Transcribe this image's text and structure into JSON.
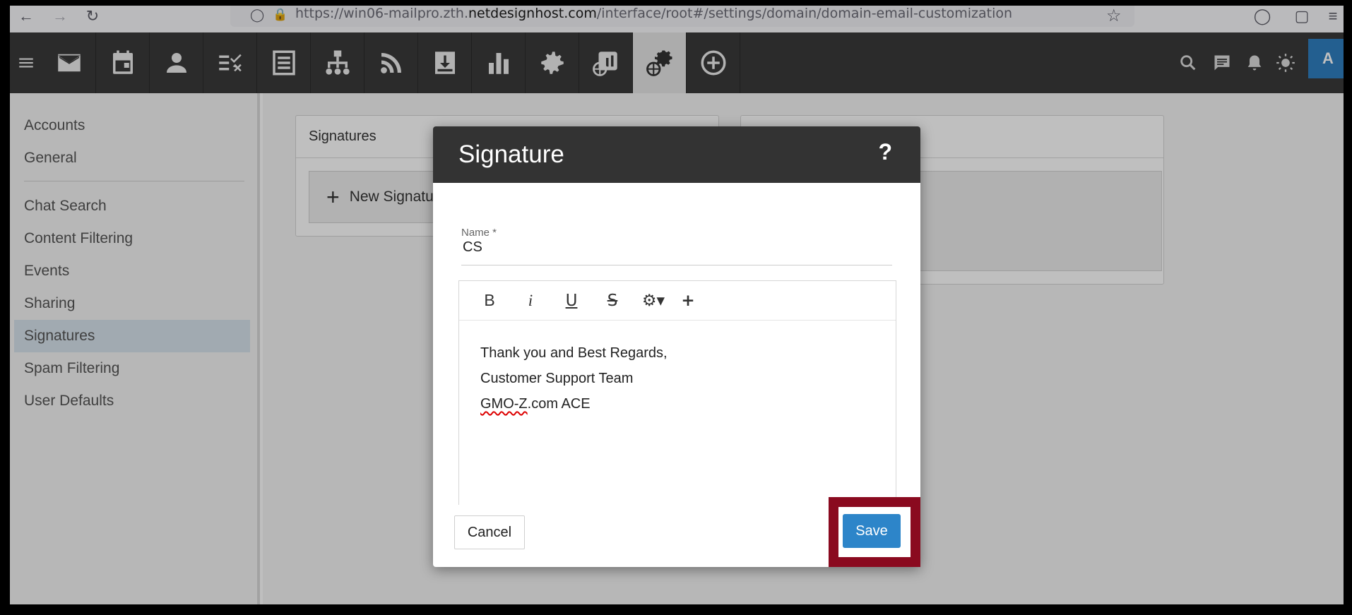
{
  "browser": {
    "url_prefix": "https://win06-mailpro.zth.",
    "url_domain": "netdesignhost.com",
    "url_suffix": "/interface/root#/settings/domain/domain-email-customization"
  },
  "appbar": {
    "icons": [
      "mail-icon",
      "calendar-icon",
      "contacts-icon",
      "tasks-icon",
      "notes-icon",
      "org-chart-icon",
      "rss-icon",
      "archive-icon",
      "reports-icon",
      "settings-icon",
      "domain-reports-icon",
      "domain-settings-icon",
      "add-icon"
    ],
    "avatar_letter": "A"
  },
  "sidebar": {
    "items": [
      "Accounts",
      "General",
      "Chat Search",
      "Content Filtering",
      "Events",
      "Sharing",
      "Signatures",
      "Spam Filtering",
      "User Defaults"
    ],
    "active": "Signatures"
  },
  "content": {
    "panel_title": "Signatures",
    "new_signature_label": "New Signature"
  },
  "dialog": {
    "title": "Signature",
    "help": "?",
    "name_label": "Name *",
    "name_value": "CS",
    "body_lines": [
      "Thank you and Best Regards,",
      "Customer Support Team",
      "GMO-Z.com ACE"
    ],
    "body_misspelled": "GMO-Z",
    "body_rest": ".com ACE",
    "cancel_label": "Cancel",
    "save_label": "Save"
  },
  "colors": {
    "appbar": "#3a3a3a",
    "save_button": "#2d85c9",
    "highlight_border": "#8a0a1f",
    "active_sidebar": "#d7e3ec"
  }
}
